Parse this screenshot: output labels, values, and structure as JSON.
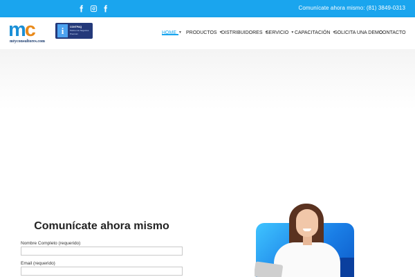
{
  "topbar": {
    "social": [
      {
        "name": "facebook-icon"
      },
      {
        "name": "instagram-icon"
      },
      {
        "name": "facebook-icon"
      }
    ],
    "contact_text": "Comunícate ahora mismo: (81) 3849-0313",
    "bg_color": "#1aa5ee"
  },
  "header": {
    "logo_letters": {
      "m": "m",
      "c": "c"
    },
    "logo_text": "mtyconsultores.com",
    "badge": {
      "letter": "i",
      "line1": "CONTPAQ",
      "line2": "Partner de Negocios",
      "line3": "Premium"
    }
  },
  "nav": {
    "items": [
      {
        "label": "HOME",
        "has_chevron": true,
        "active": true
      },
      {
        "label": "PRODUCTOS",
        "has_chevron": true
      },
      {
        "label": "DISTRIBUIDORES",
        "has_chevron": true
      },
      {
        "label": "SERVICIO",
        "has_chevron": true
      },
      {
        "label": "CAPACITACIÓN",
        "has_chevron": true
      },
      {
        "label": "SOLICITA UNA DEMO",
        "has_chevron": false
      },
      {
        "label": "CONTACTO",
        "has_chevron": false
      }
    ],
    "accent_color": "#1aa5ee"
  },
  "form": {
    "title": "Comunícate ahora mismo",
    "fields": [
      {
        "label": "Nombre Completo (requerido)",
        "value": ""
      },
      {
        "label": "Email (requerido)",
        "value": ""
      }
    ]
  }
}
